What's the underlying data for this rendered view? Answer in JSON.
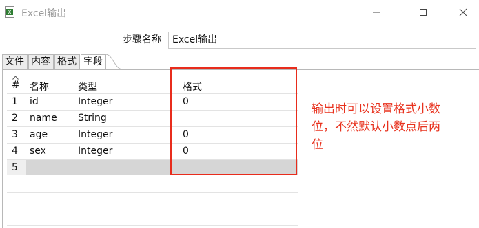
{
  "window": {
    "title": "Excel输出",
    "icon": "excel-icon"
  },
  "step": {
    "label": "步骤名称",
    "value": "Excel输出"
  },
  "tabs": [
    {
      "label": "文件"
    },
    {
      "label": "内容"
    },
    {
      "label": "格式"
    },
    {
      "label": "字段",
      "active": true
    }
  ],
  "table": {
    "headers": [
      "#",
      "名称",
      "类型",
      "格式"
    ],
    "rows": [
      {
        "num": "1",
        "name": "id",
        "type": "Integer",
        "format": "0"
      },
      {
        "num": "2",
        "name": "name",
        "type": "String",
        "format": ""
      },
      {
        "num": "3",
        "name": "age",
        "type": "Integer",
        "format": "0"
      },
      {
        "num": "4",
        "name": "sex",
        "type": "Integer",
        "format": "0"
      },
      {
        "num": "5",
        "name": "",
        "type": "",
        "format": ""
      }
    ],
    "selected_row": 5
  },
  "annotation": {
    "text": "输出时可以设置格式小数位，不然默认小数点后两位",
    "color": "#e8321e"
  }
}
